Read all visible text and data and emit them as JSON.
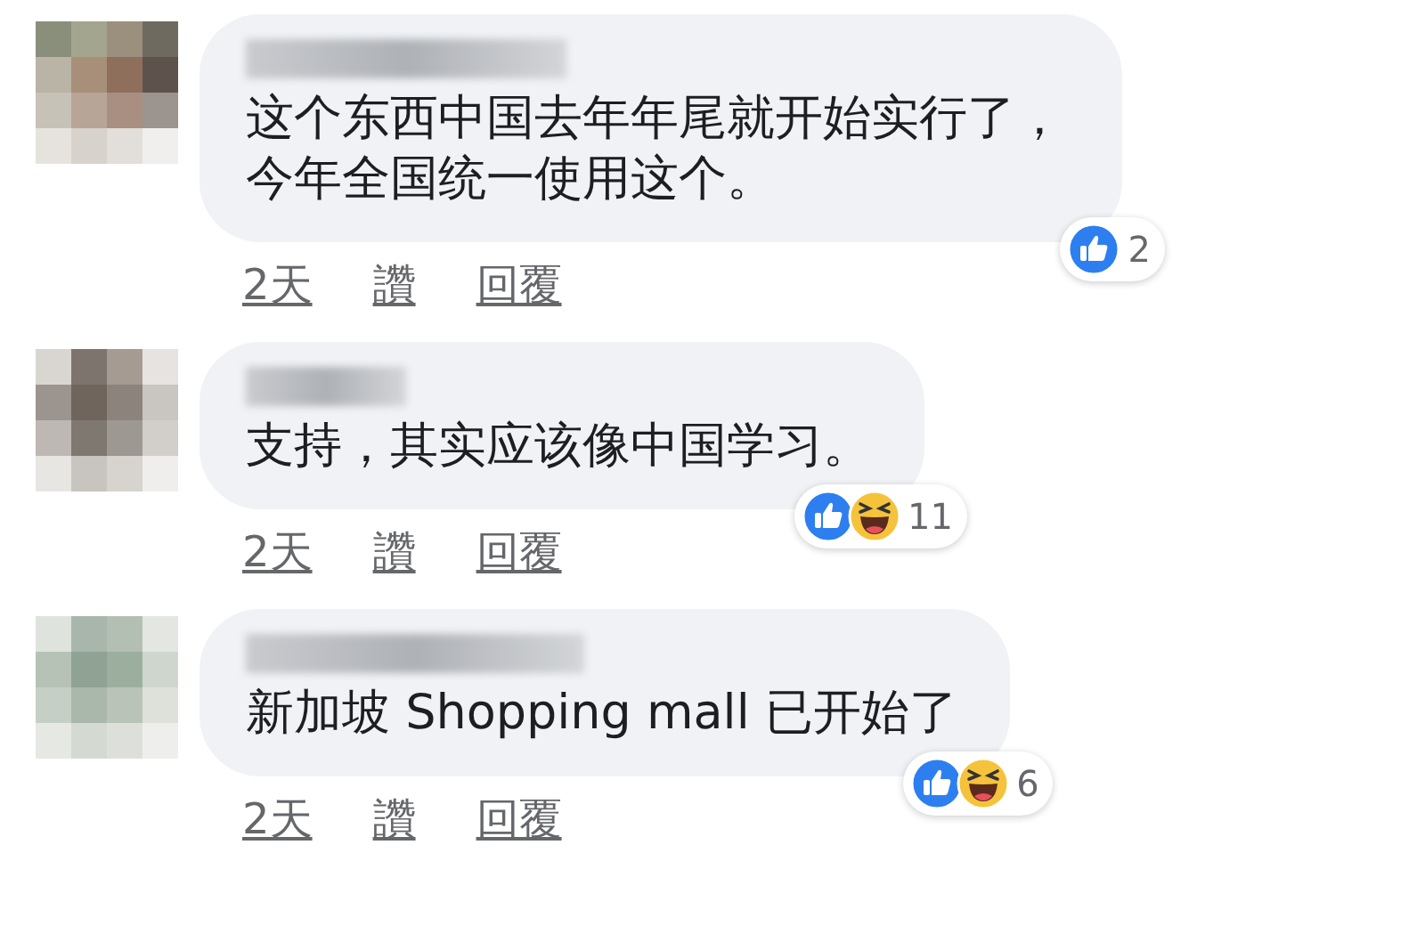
{
  "comments": [
    {
      "text": "这个东西中国去年年尾就开始实行了，今年全国统一使用这个。",
      "reactions": [
        {
          "kind": "like"
        }
      ],
      "reaction_count": "2",
      "time": "2天",
      "like_link": "讚",
      "reply_link": "回覆"
    },
    {
      "text": "支持，其实应该像中国学习。",
      "reactions": [
        {
          "kind": "like"
        },
        {
          "kind": "haha"
        }
      ],
      "reaction_count": "11",
      "time": "2天",
      "like_link": "讚",
      "reply_link": "回覆"
    },
    {
      "text": "新加坡 Shopping mall 已开始了",
      "reactions": [
        {
          "kind": "like"
        },
        {
          "kind": "haha"
        }
      ],
      "reaction_count": "6",
      "time": "2天",
      "like_link": "讚",
      "reply_link": "回覆"
    }
  ]
}
